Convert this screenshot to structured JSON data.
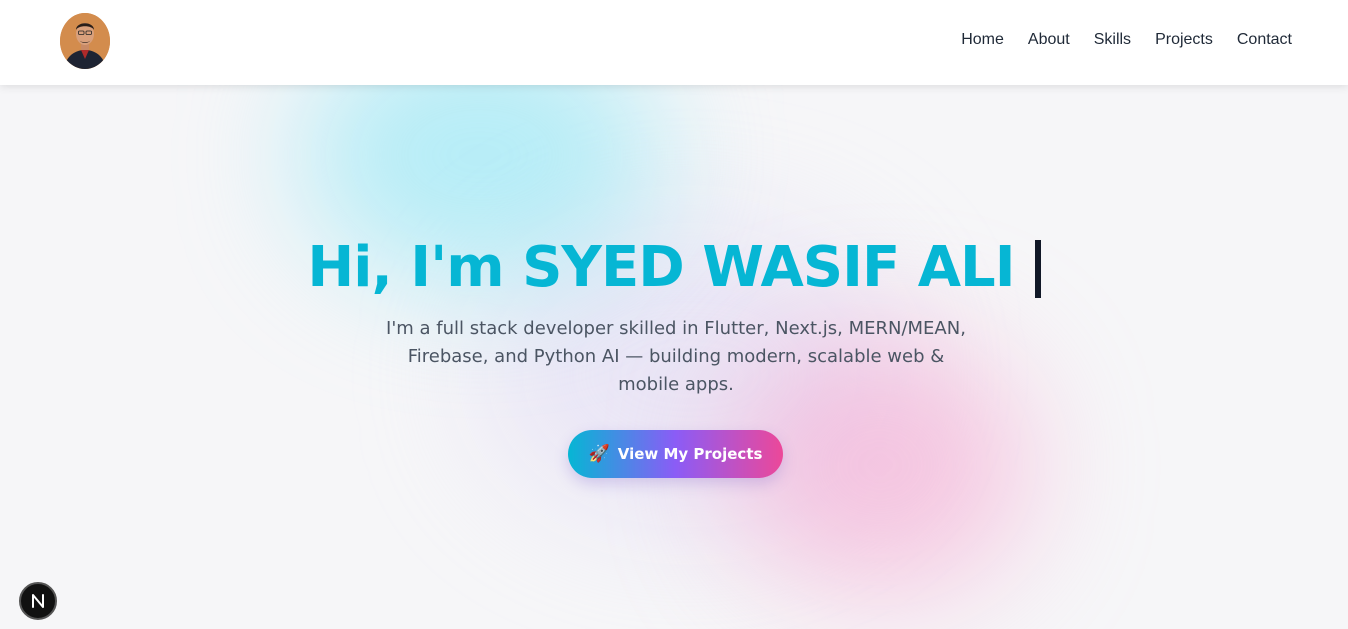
{
  "header": {
    "avatar_alt": "Profile photo",
    "nav": [
      {
        "label": "Home"
      },
      {
        "label": "About"
      },
      {
        "label": "Skills"
      },
      {
        "label": "Projects"
      },
      {
        "label": "Contact"
      }
    ]
  },
  "hero": {
    "headline": "Hi, I'm SYED WASIF ALI",
    "subtext": "I'm a full stack developer skilled in Flutter, Next.js, MERN/MEAN, Firebase, and Python AI — building modern, scalable web & mobile apps.",
    "cta_label": "View My Projects",
    "cta_icon": "rocket-icon"
  },
  "dev_badge": {
    "letter": "N",
    "icon": "nextjs-icon"
  },
  "colors": {
    "accent": "#06b6d4",
    "gradient_start": "#06b6d4",
    "gradient_mid": "#8b5cf6",
    "gradient_end": "#ec4899",
    "text_dark": "#1f2937",
    "text_muted": "#4b5563"
  }
}
